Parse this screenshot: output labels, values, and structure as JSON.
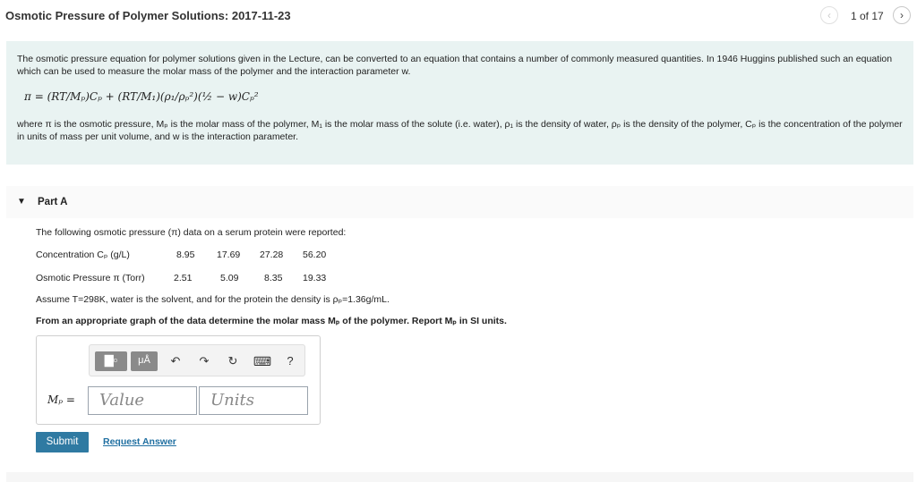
{
  "header": {
    "title": "Osmotic Pressure of Polymer Solutions: 2017-11-23",
    "page_count": "1 of 17",
    "prev_icon": "‹",
    "next_icon": "›"
  },
  "intro": {
    "paragraph1": "The osmotic pressure equation for polymer solutions given in the Lecture, can be converted to an equation that contains a number of commonly measured quantities. In 1946 Huggins published such an equation which can be used to measure the molar mass of the polymer and the interaction parameter w.",
    "equation": "π = (RT/Mₚ)Cₚ + (RT/M₁)(ρ₁/ρₚ²)(½ − w)Cₚ²",
    "paragraph2": "where π is the osmotic pressure, Mₚ is the molar mass of the polymer, M₁ is the molar mass of the solute (i.e. water), ρ₁ is the density of water, ρₚ is the density of the polymer, Cₚ is the concentration of the polymer in units of mass per unit volume, and w is the interaction parameter."
  },
  "part": {
    "caret": "▼",
    "title": "Part A",
    "data_intro": "The following osmotic pressure (π) data on a serum protein were reported:",
    "table": {
      "rows": [
        {
          "label": "Concentration Cₚ (g/L)",
          "values": [
            "8.95",
            "17.69",
            "27.28",
            "56.20"
          ]
        },
        {
          "label": "Osmotic Pressure π (Torr)",
          "values": [
            "2.51",
            "5.09",
            "8.35",
            "19.33"
          ]
        }
      ]
    },
    "assumption": "Assume T=298K, water is the solvent, and for the protein the density is ρₚ=1.36g/mL.",
    "question": "From an appropriate graph of the data determine the molar mass Mₚ of the polymer. Report Mₚ in SI units."
  },
  "answer": {
    "label": "Mₚ =",
    "value_placeholder": "Value",
    "units_placeholder": "Units",
    "toolbar": {
      "templates_icon": "▇▫",
      "units_icon": "μÅ",
      "undo_icon": "↶",
      "redo_icon": "↷",
      "reset_icon": "↻",
      "keyboard_icon": "⌨",
      "help_icon": "?"
    }
  },
  "actions": {
    "submit": "Submit",
    "request": "Request Answer"
  }
}
